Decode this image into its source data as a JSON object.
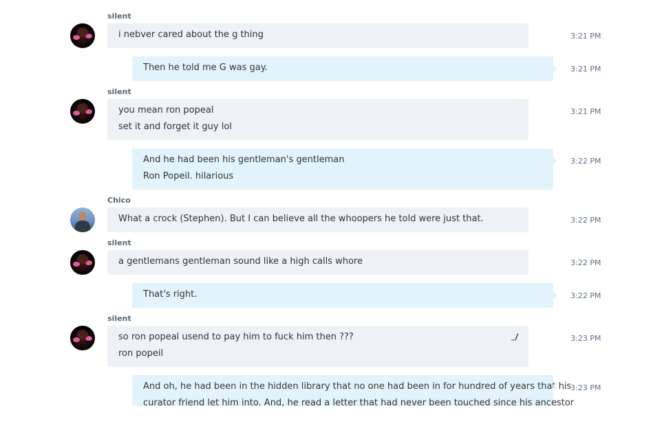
{
  "messages": [
    {
      "sender": "silent",
      "direction": "in",
      "lines": [
        "i nebver cared about the g  thing"
      ],
      "time": "3:21 PM"
    },
    {
      "direction": "out",
      "lines": [
        "Then he told me G was gay."
      ],
      "time": "3:21 PM"
    },
    {
      "sender": "silent",
      "direction": "in",
      "lines": [
        "you mean ron popeal",
        "set it and forget it guy  lol"
      ],
      "time": "3:21 PM"
    },
    {
      "direction": "out",
      "lines": [
        "And he had been his gentleman's gentleman",
        "Ron Popeil.  hilarious"
      ],
      "time": "3:22 PM"
    },
    {
      "sender": "Chico",
      "direction": "in",
      "lines": [
        "What a crock (Stephen).  But I can believe all the whoopers he told were just that."
      ],
      "time": "3:22 PM"
    },
    {
      "sender": "silent",
      "direction": "in",
      "lines": [
        "a gentlemans gentleman sound like a high calls whore"
      ],
      "time": "3:22 PM"
    },
    {
      "direction": "out",
      "lines": [
        "That's right."
      ],
      "time": "3:22 PM"
    },
    {
      "sender": "silent",
      "direction": "in",
      "lines": [
        "so ron popeal usend to pay him to fuck him then ???",
        "ron popeil"
      ],
      "time": "3:23 PM",
      "edited": true
    },
    {
      "direction": "out",
      "lines": [
        "And oh, he had been in the hidden library that no one had been in for hundred of years that his",
        "curator friend let him into.  And, he read a letter that had never been touched since his ancestor"
      ],
      "time": "3:23 PM"
    }
  ],
  "icons": {
    "edit": "pencil-edited-icon"
  },
  "colors": {
    "incoming_bubble": "#eef1f6",
    "outgoing_bubble": "#e3f3fb",
    "timestamp": "#5d6f83"
  }
}
